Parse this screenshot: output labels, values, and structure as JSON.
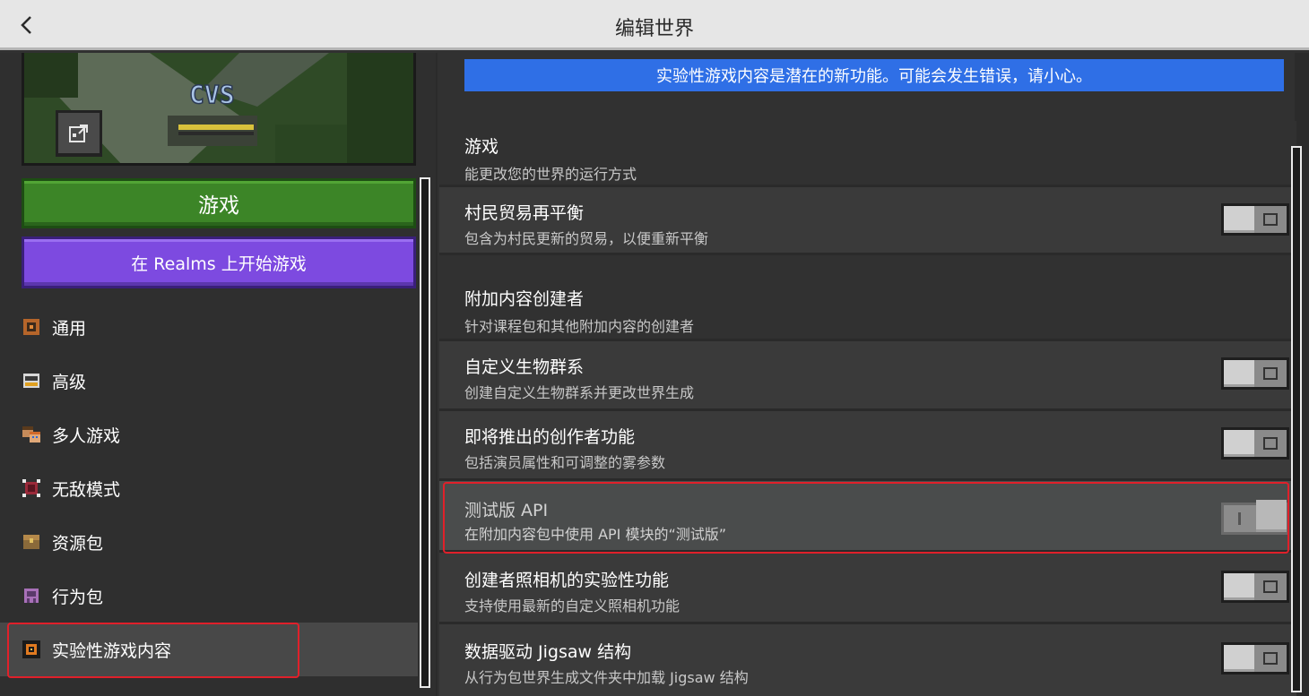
{
  "header": {
    "title": "编辑世界"
  },
  "left": {
    "thumbnail_text": "CVS",
    "play_label": "游戏",
    "realms_label": "在 Realms 上开始游戏",
    "nav": [
      {
        "label": "通用",
        "icon": "gear-icon"
      },
      {
        "label": "高级",
        "icon": "advanced-icon"
      },
      {
        "label": "多人游戏",
        "icon": "multiplayer-icon"
      },
      {
        "label": "无敌模式",
        "icon": "cheats-icon"
      },
      {
        "label": "资源包",
        "icon": "resource-pack-icon"
      },
      {
        "label": "行为包",
        "icon": "behavior-pack-icon"
      },
      {
        "label": "实验性游戏内容",
        "icon": "experiments-icon",
        "selected": true
      }
    ]
  },
  "right": {
    "warning": "实验性游戏内容是潜在的新功能。可能会发生错误，请小心。",
    "section_game": {
      "title": "游戏",
      "desc": "能更改您的世界的运行方式"
    },
    "villager": {
      "title": "村民贸易再平衡",
      "desc": "包含为村民更新的贸易，以便重新平衡",
      "state": "off"
    },
    "section_addon": {
      "title": "附加内容创建者",
      "desc": "针对课程包和其他附加内容的创建者"
    },
    "biomes": {
      "title": "自定义生物群系",
      "desc": "创建自定义生物群系并更改世界生成",
      "state": "off"
    },
    "upcoming": {
      "title": "即将推出的创作者功能",
      "desc": "包括演员属性和可调整的雾参数",
      "state": "off"
    },
    "beta_api": {
      "title": "测试版 API",
      "desc": "在附加内容包中使用 API 模块的“测试版”",
      "state": "on (locked)"
    },
    "camera": {
      "title": "创建者照相机的实验性功能",
      "desc": "支持使用最新的自定义照相机功能",
      "state": "off"
    },
    "jigsaw": {
      "title": "数据驱动 Jigsaw 结构",
      "desc": "从行为包世界生成文件夹中加载 Jigsaw 结构",
      "state": "off"
    }
  },
  "colors": {
    "header_bg": "#e6e6e6",
    "play_green": "#3c8527",
    "realms_purple": "#7d4ae0",
    "warning_blue": "#2f6fe6",
    "highlight_red": "#e0202a"
  }
}
